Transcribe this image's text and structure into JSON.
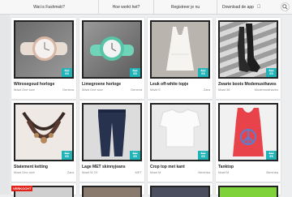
{
  "nav": {
    "links": [
      {
        "label": "Wat is Fashmob?"
      },
      {
        "label": "Hoe werkt het?"
      },
      {
        "label": "Registreer je nu"
      },
      {
        "label": "Download de app"
      }
    ]
  },
  "listings": [
    {
      "title": "Witrosegoud horloge",
      "size": "Maat One size",
      "brand": "Geneva",
      "old_price": "€12",
      "price": "€5"
    },
    {
      "title": "Limegroene horloge",
      "size": "Maat One size",
      "brand": "Geneva",
      "old_price": "€12",
      "price": "€5"
    },
    {
      "title": "Leuk off-white topje",
      "size": "Maat S",
      "brand": "Zara",
      "old_price": "€12",
      "price": "€5"
    },
    {
      "title": "Zwarte boots Modemusthaves",
      "size": "Maat 38",
      "brand": "Modemusthaves",
      "old_price": "€12",
      "price": "€5"
    },
    {
      "title": "Statement ketting",
      "size": "Maat One size",
      "brand": "Zara",
      "old_price": "€10",
      "price": "€5"
    },
    {
      "title": "Lage MET skinnyjeans",
      "size": "Maat W 29",
      "brand": "MET",
      "old_price": "€10",
      "price": "€5"
    },
    {
      "title": "Crop top met kant",
      "size": "Maat M",
      "brand": "Bershka",
      "old_price": "€12",
      "price": "€5"
    },
    {
      "title": "Tanktop",
      "size": "Maat M",
      "brand": "Bershka",
      "old_price": "€12",
      "price": "€5"
    }
  ],
  "bottom_badge": "VERKOCHT",
  "colors": {
    "accent": "#20b3b7",
    "sold": "#e2231a"
  }
}
